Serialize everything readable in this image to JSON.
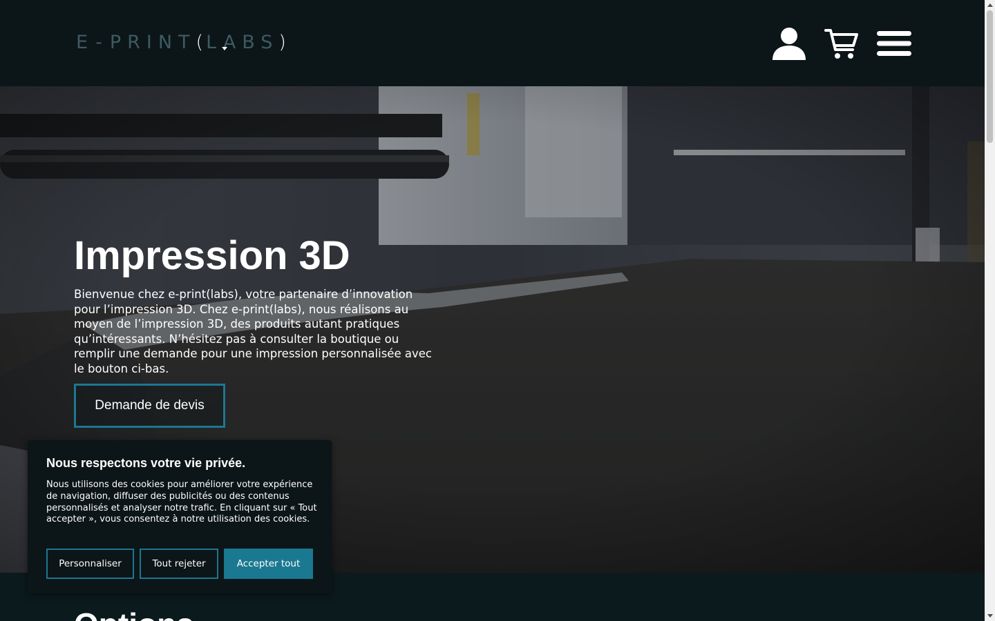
{
  "header": {
    "logo": {
      "e": "E",
      "dash": "-",
      "print": "PRINT",
      "open_paren": "(",
      "labs": "LABS",
      "close_paren": ")"
    },
    "icons": [
      "user-icon",
      "cart-icon",
      "menu-icon"
    ]
  },
  "hero": {
    "title": "Impression 3D",
    "text": "Bienvenue chez e-print(labs), votre partenaire d’innovation pour l’impression 3D. Chez e-print(labs), nous réalisons au moyen de l’impression 3D, des produits autant pratiques qu’intéressants. N’hésitez pas à consulter la boutique ou remplir une demande pour une impression personnalisée avec le bouton ci-bas.",
    "cta_label": "Demande de devis"
  },
  "options": {
    "title": "Options"
  },
  "cookie": {
    "title": "Nous respectons votre vie privée.",
    "text": "Nous utilisons des cookies pour améliorer votre expérience de navigation, diffuser des publicités ou des contenus personnalisés et analyser notre trafic. En cliquant sur « Tout accepter », vous consentez à notre utilisation des cookies.",
    "customize_label": "Personnaliser",
    "reject_label": "Tout rejeter",
    "accept_label": "Accepter tout"
  },
  "colors": {
    "background": "#0c1517",
    "accent": "#1b7891",
    "logo_muted": "#3e5a62"
  }
}
